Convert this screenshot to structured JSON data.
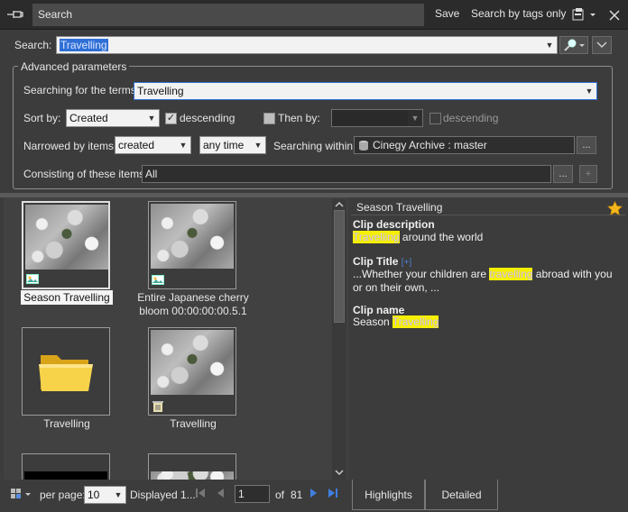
{
  "window": {
    "title": "Search",
    "save_label": "Save",
    "search_by_tags_label": "Search by tags only"
  },
  "search": {
    "label": "Search:",
    "value": "Travelling"
  },
  "advanced": {
    "legend": "Advanced parameters",
    "terms_label": "Searching for the terms:",
    "terms_value": "Travelling",
    "sort_label": "Sort by:",
    "sort_value": "Created",
    "descending_label": "descending",
    "descending_checked": true,
    "then_by_label": "Then by:",
    "then_by_value": "",
    "then_descending_label": "descending",
    "narrowed_label": "Narrowed by items:",
    "narrowed_value": "created",
    "time_value": "any time",
    "within_label": "Searching within:",
    "within_value": "Cinegy Archive : master",
    "consisting_label": "Consisting of these items:",
    "consisting_value": "All",
    "ellipsis": "...",
    "plus": "+"
  },
  "results": [
    {
      "caption": "Season Travelling",
      "selected": true,
      "type": "clip"
    },
    {
      "caption": "Entire Japanese cherry bloom 00:00:00:00.5.1",
      "selected": false,
      "type": "clip"
    },
    {
      "caption": "Travelling",
      "selected": false,
      "type": "folder"
    },
    {
      "caption": "Travelling",
      "selected": false,
      "type": "deleted-clip"
    }
  ],
  "details": {
    "header": "Season Travelling",
    "desc_title": "Clip description",
    "desc_hl": "Travelling",
    "desc_rest": " around the world",
    "title_title": "Clip Title",
    "title_suffix": "[+]",
    "title_pre": "...Whether your children are ",
    "title_hl": "travelling",
    "title_post": " abroad with you or on their own, ...",
    "name_title": "Clip name",
    "name_pre": "Season ",
    "name_hl": "Travelling"
  },
  "pager": {
    "per_page_label": "per page:",
    "per_page_value": "10",
    "displayed_label": "Displayed 1...",
    "page_value": "1",
    "of_label": "of",
    "total_pages": "81"
  },
  "tabs": {
    "highlights": "Highlights",
    "detailed": "Detailed"
  },
  "colors": {
    "highlight": "#f6f000",
    "accent": "#2f6fd6",
    "background": "#3c3c3c"
  }
}
